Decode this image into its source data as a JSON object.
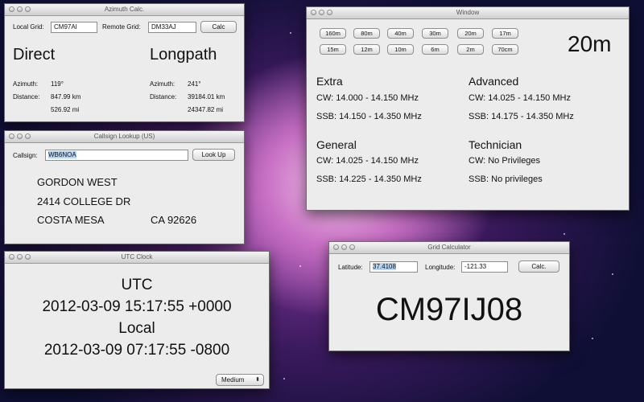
{
  "azimuth": {
    "title": "Azimuth Calc.",
    "local_grid_label": "Local Grid:",
    "local_grid_value": "CM97AI",
    "remote_grid_label": "Remote Grid:",
    "remote_grid_value": "DM33AJ",
    "calc_button": "Calc",
    "direct_heading": "Direct",
    "longpath_heading": "Longpath",
    "azimuth_label": "Azimuth:",
    "distance_label": "Distance:",
    "direct_azimuth": "119°",
    "direct_km": "847.99 km",
    "direct_mi": "526.92  mi",
    "long_azimuth": "241°",
    "long_km": "39184.01 km",
    "long_mi": "24347.82  mi"
  },
  "callsign": {
    "title": "Callsign Lookup (US)",
    "label": "Callsign:",
    "value": "WB6NOA",
    "lookup_button": "Look Up",
    "name": "GORDON WEST",
    "street": "2414 COLLEGE DR",
    "city": "COSTA MESA",
    "state_zip": "CA  92626"
  },
  "utc": {
    "title": "UTC Clock",
    "utc_label": "UTC",
    "utc_time": "2012-03-09 15:17:55 +0000",
    "local_label": "Local",
    "local_time": "2012-03-09 07:17:55 -0800",
    "size_select": "Medium"
  },
  "bands": {
    "title": "Window",
    "row1": [
      "160m",
      "80m",
      "40m",
      "30m",
      "20m",
      "17m"
    ],
    "row2": [
      "15m",
      "12m",
      "10m",
      "6m",
      "2m",
      "70cm"
    ],
    "selected_band": "20m",
    "extra": {
      "heading": "Extra",
      "cw": "CW: 14.000 - 14.150 MHz",
      "ssb": "SSB: 14.150 - 14.350 MHz"
    },
    "advanced": {
      "heading": "Advanced",
      "cw": "CW: 14.025 - 14.150 MHz",
      "ssb": "SSB: 14.175 - 14.350 MHz"
    },
    "general": {
      "heading": "General",
      "cw": "CW: 14.025 - 14.150 MHz",
      "ssb": "SSB: 14.225 - 14.350 MHz"
    },
    "technician": {
      "heading": "Technician",
      "cw": "CW: No Privileges",
      "ssb": "SSB: No privileges"
    }
  },
  "grid": {
    "title": "Grid Calculator",
    "latitude_label": "Latitude:",
    "latitude_value": "37.4108",
    "longitude_label": "Longitude:",
    "longitude_value": "-121.33",
    "calc_button": "Calc.",
    "result": "CM97IJ08"
  }
}
